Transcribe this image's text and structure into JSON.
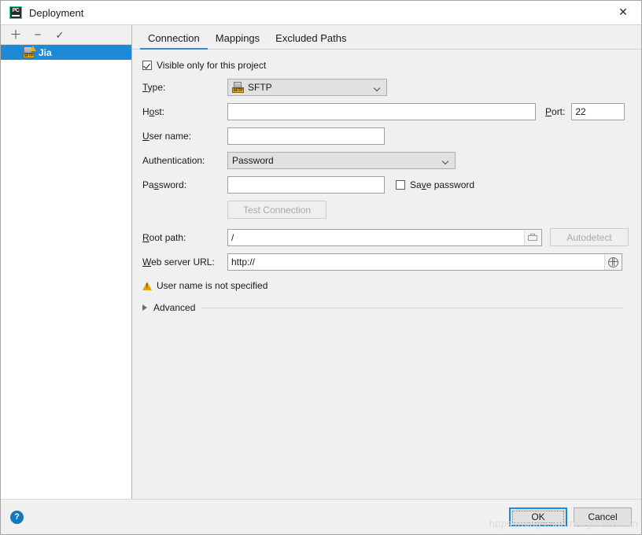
{
  "window": {
    "title": "Deployment",
    "app_icon": "pycharm-icon",
    "close_label": "✕"
  },
  "sidebar": {
    "toolbar": [
      {
        "name": "add",
        "glyph": "＋"
      },
      {
        "name": "remove",
        "glyph": "−"
      },
      {
        "name": "set-default",
        "glyph": "✓"
      }
    ],
    "items": [
      {
        "label": "Jia",
        "icon": "sftp-warning-icon",
        "icon_text": "SFTP",
        "selected": true
      }
    ]
  },
  "tabs": [
    {
      "label": "Connection",
      "active": true
    },
    {
      "label": "Mappings",
      "active": false
    },
    {
      "label": "Excluded Paths",
      "active": false
    }
  ],
  "form": {
    "visible_only": {
      "label_pre": "",
      "label": "Visible only for this project",
      "checked": true
    },
    "type": {
      "label": "Type:",
      "mnemonic": "T",
      "value": "SFTP",
      "icon": "sftp-icon",
      "icon_text": "SFTP"
    },
    "host": {
      "label": "Host:",
      "mnemonic": "o",
      "value": "",
      "placeholder": ""
    },
    "port": {
      "label": "Port:",
      "mnemonic": "P",
      "value": "22"
    },
    "user_name": {
      "label": "User name:",
      "mnemonic": "U",
      "value": "",
      "placeholder": ""
    },
    "authentication": {
      "label": "Authentication:",
      "value": "Password"
    },
    "password": {
      "label": "Password:",
      "mnemonic": "s",
      "value": "",
      "placeholder": ""
    },
    "save_password": {
      "label": "Save password",
      "checked": false
    },
    "test_connection": {
      "label": "Test Connection",
      "enabled": false
    },
    "root_path": {
      "label": "Root path:",
      "mnemonic": "R",
      "value": "/",
      "browse_icon": "folder-icon"
    },
    "autodetect": {
      "label": "Autodetect",
      "enabled": false
    },
    "web_server_url": {
      "label": "Web server URL:",
      "mnemonic": "W",
      "value": "http://",
      "open_icon": "globe-icon"
    },
    "warning": {
      "icon": "warning-triangle-icon",
      "text": "User name is not specified"
    },
    "advanced": {
      "label": "Advanced",
      "expanded": false,
      "icon": "chevron-right-icon"
    }
  },
  "footer": {
    "help": {
      "label": "?",
      "name": "help-icon"
    },
    "ok": {
      "label": "OK",
      "default": true
    },
    "cancel": {
      "label": "Cancel"
    },
    "watermark": "https://blog.csdn.net/yinzhentan"
  },
  "colors": {
    "accent": "#1e8ad6",
    "tab_underline": "#3f87c9",
    "warning": "#eda200",
    "selection": "#1e8ad6",
    "sftp_badge": "#f0a81e"
  }
}
